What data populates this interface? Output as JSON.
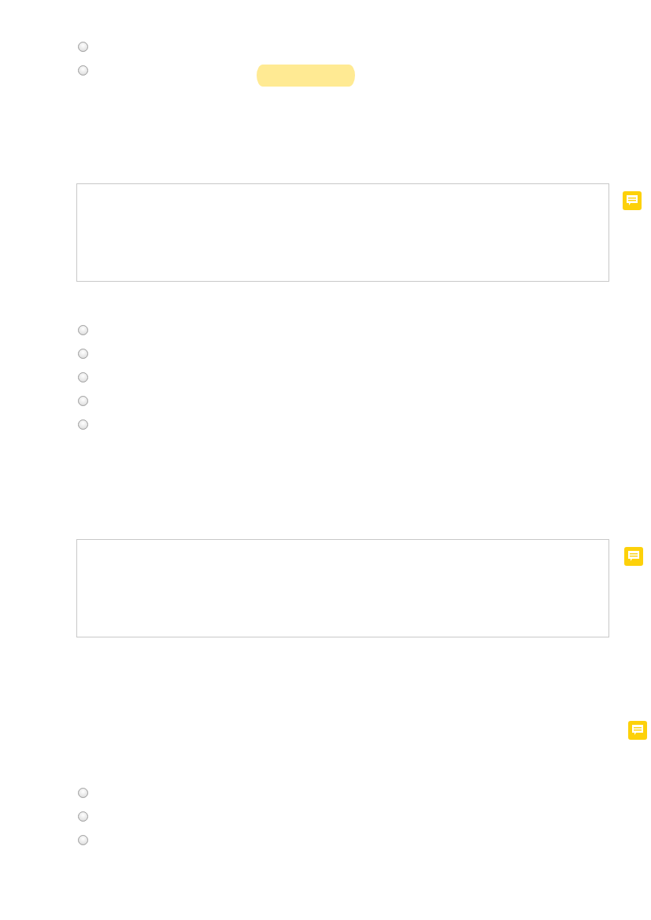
{
  "sections": [
    {
      "kind": "choices",
      "options": [
        {
          "selected": false,
          "highlighted": false
        },
        {
          "selected": false,
          "highlighted": true
        }
      ]
    },
    {
      "kind": "answer",
      "comment": true
    },
    {
      "kind": "choices",
      "options": [
        {
          "selected": false,
          "highlighted": false
        },
        {
          "selected": false,
          "highlighted": false
        },
        {
          "selected": false,
          "highlighted": false
        },
        {
          "selected": false,
          "highlighted": false
        },
        {
          "selected": false,
          "highlighted": false
        }
      ]
    },
    {
      "kind": "answer",
      "comment": true
    },
    {
      "kind": "comment"
    },
    {
      "kind": "choices",
      "options": [
        {
          "selected": false,
          "highlighted": false
        },
        {
          "selected": false,
          "highlighted": false
        },
        {
          "selected": false,
          "highlighted": false
        }
      ]
    }
  ]
}
